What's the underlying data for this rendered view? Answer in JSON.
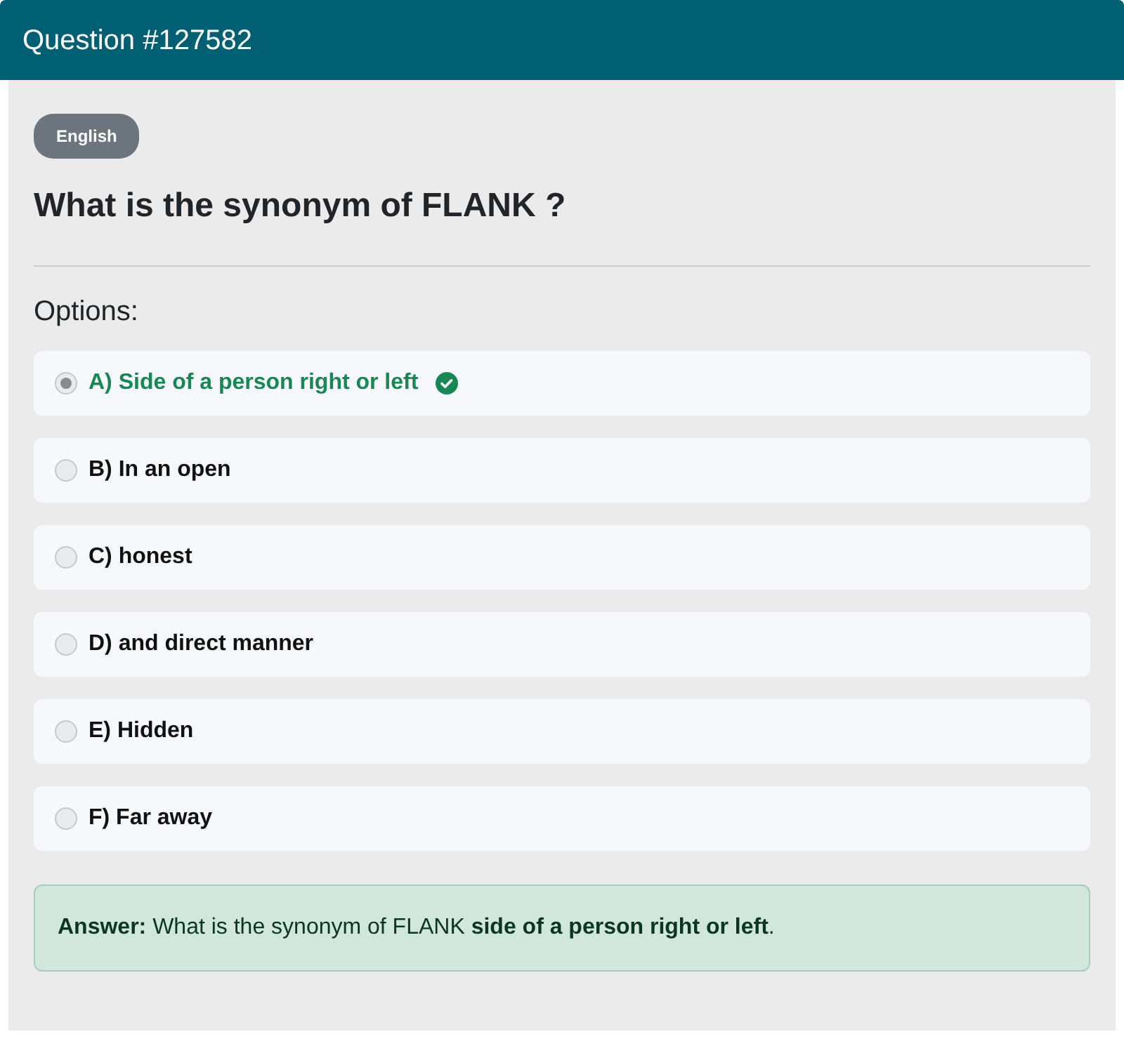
{
  "header": {
    "title": "Question #127582"
  },
  "badge": "English",
  "question": "What is the synonym of FLANK ?",
  "options_heading": "Options:",
  "options": [
    {
      "label": "A) Side of a person right or left",
      "selected": true,
      "correct": true
    },
    {
      "label": "B) In an open",
      "selected": false,
      "correct": false
    },
    {
      "label": "C) honest",
      "selected": false,
      "correct": false
    },
    {
      "label": "D) and direct manner",
      "selected": false,
      "correct": false
    },
    {
      "label": "E) Hidden",
      "selected": false,
      "correct": false
    },
    {
      "label": "F) Far away",
      "selected": false,
      "correct": false
    }
  ],
  "answer": "**Answer:** What is the synonym of FLANK **side of a person right or left**."
}
